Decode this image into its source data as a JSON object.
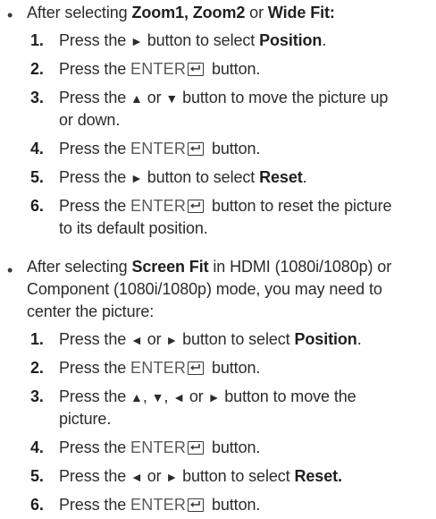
{
  "section1": {
    "bullet": "•",
    "intro_prefix": "After selecting ",
    "zoom1": "Zoom1, Zoom2",
    "or": " or ",
    "widefit": "Wide Fit:",
    "steps": [
      {
        "num": "1.",
        "a": "Press the ",
        "arrow1": "►",
        "b": " button to select ",
        "bold": "Position",
        "c": "."
      },
      {
        "num": "2.",
        "a": "Press the ",
        "enter": "ENTER",
        "b": " button."
      },
      {
        "num": "3.",
        "a": "Press the ",
        "up": "▲",
        "or": " or ",
        "down": "▼",
        "b": " button to move the picture up",
        "c": "or down."
      },
      {
        "num": "4.",
        "a": "Press the ",
        "enter": "ENTER",
        "b": " button."
      },
      {
        "num": "5.",
        "a": "Press the ",
        "arrow1": "►",
        "b": " button to select ",
        "bold": "Reset",
        "c": "."
      },
      {
        "num": "6.",
        "a": "Press the ",
        "enter": "ENTER",
        "b": " button to reset the picture",
        "c": "to its default position."
      }
    ]
  },
  "section2": {
    "bullet": "•",
    "line1_a": "After selecting ",
    "screenfit": "Screen Fit",
    "line1_b": " in HDMI (1080i/1080p) or",
    "line2": "Component (1080i/1080p) mode, you may need to",
    "line3": "center the picture:",
    "steps": [
      {
        "num": "1.",
        "a": "Press the ",
        "left": "◄",
        "or": " or ",
        "right": "►",
        "b": " button to select ",
        "bold": "Position",
        "c": "."
      },
      {
        "num": "2.",
        "a": "Press the ",
        "enter": "ENTER",
        "b": " button."
      },
      {
        "num": "3.",
        "a": "Press the ",
        "up": "▲",
        "comma1": ", ",
        "down": "▼",
        "comma2": ", ",
        "left": "◄",
        "or": " or ",
        "right": "►",
        "b": " button to move the",
        "c": "picture."
      },
      {
        "num": "4.",
        "a": "Press the ",
        "enter": "ENTER",
        "b": " button."
      },
      {
        "num": "5.",
        "a": "Press the ",
        "left": "◄",
        "or": " or ",
        "right": "►",
        "b": " button to select ",
        "bold": "Reset."
      },
      {
        "num": "6.",
        "a": "Press the ",
        "enter": "ENTER",
        "b": " button."
      }
    ]
  }
}
